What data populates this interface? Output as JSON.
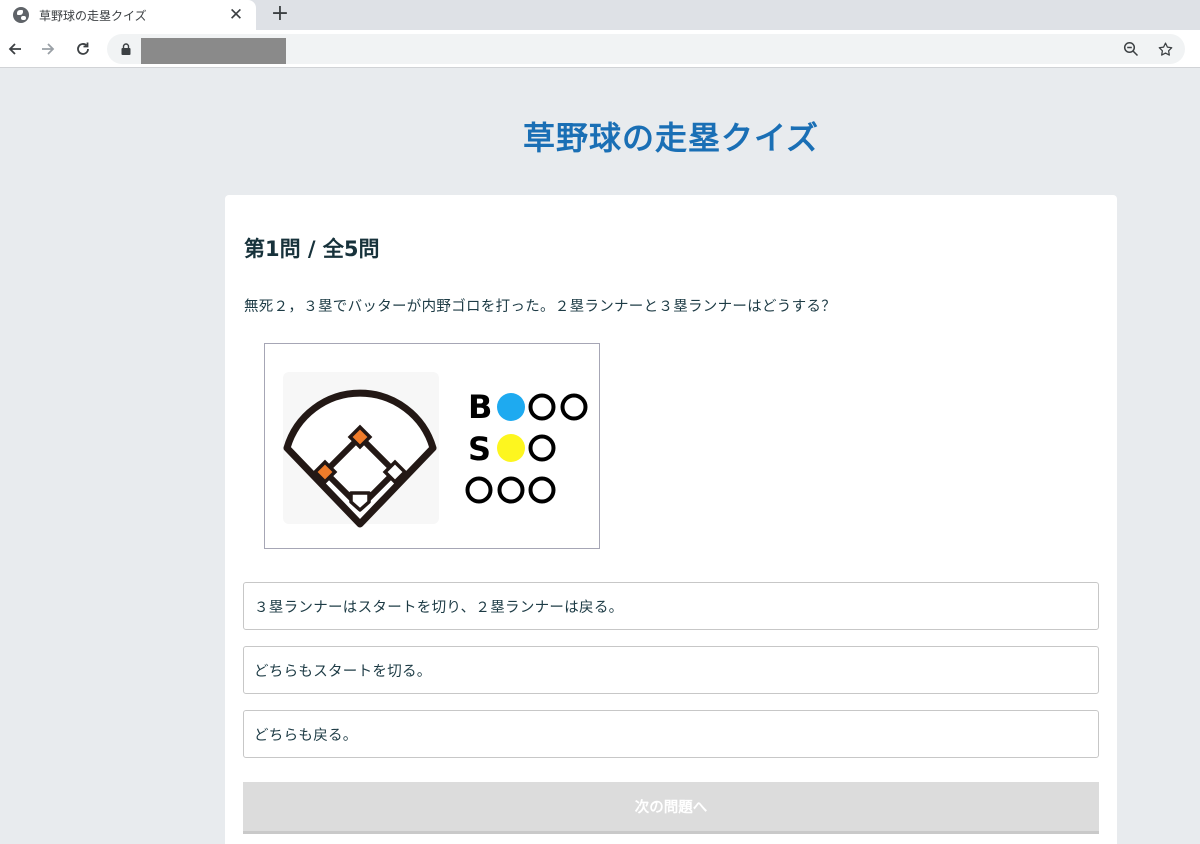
{
  "browser": {
    "tab_title": "草野球の走塁クイズ",
    "close_glyph": "✕",
    "newtab_glyph": "+",
    "url_masked": true
  },
  "page": {
    "title": "草野球の走塁クイズ"
  },
  "quiz": {
    "heading": "第1問 / 全5問",
    "question": "無死２，３塁でバッターが内野ゴロを打った。２塁ランナーと３塁ランナーはどうする？",
    "figure": {
      "runners_on": [
        "second",
        "third"
      ],
      "count_rows": [
        {
          "label": "B",
          "filled": 1,
          "total": 3,
          "color": "#1eaaf0"
        },
        {
          "label": "S",
          "filled": 1,
          "total": 2,
          "color": "#fdf61f"
        },
        {
          "label": "",
          "filled": 0,
          "total": 3,
          "color": "#000000"
        }
      ]
    },
    "options": [
      "３塁ランナーはスタートを切り、２塁ランナーは戻る。",
      "どちらもスタートを切る。",
      "どちらも戻る。"
    ],
    "next_label": "次の問題へ"
  },
  "colors": {
    "title": "#1a6fb5",
    "runner": "#f07c2a",
    "ball_dot": "#1eaaf0",
    "strike_dot": "#fdf61f"
  }
}
